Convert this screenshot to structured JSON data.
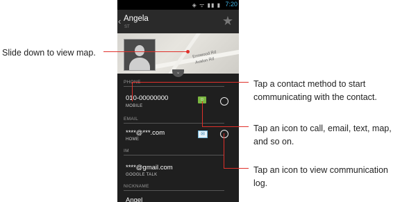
{
  "colors": {
    "callout_line": "#e0302a",
    "accent": "#3fb5e6"
  },
  "callouts": {
    "map": "Slide down to view map.",
    "contact_method": "Tap a contact method to start communicating with the contact.",
    "icon_action": "Tap an icon to call, email, text, map, and so on.",
    "log": "Tap an icon to view communication log."
  },
  "status_bar": {
    "time": "7:20"
  },
  "contact": {
    "name": "Angela",
    "subtitle": "ST",
    "favorite_icon": "star-icon"
  },
  "map": {
    "street_1": "Ermwood Rd",
    "street_2": "Avalon Rd"
  },
  "sections": {
    "phone": {
      "header": "PHONE",
      "value": "010-00000000",
      "type": "MOBILE"
    },
    "email": {
      "header": "EMAIL",
      "value": "****@***.com",
      "type": "HOME"
    },
    "im": {
      "header": "IM",
      "value": "****@gmail.com",
      "type": "GOOGLE TALK"
    },
    "nickname": {
      "header": "NICKNAME",
      "value": "Angel"
    }
  }
}
